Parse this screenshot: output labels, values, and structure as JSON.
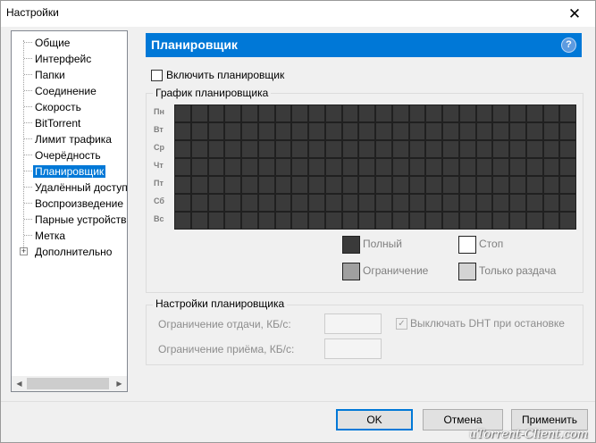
{
  "window": {
    "title": "Настройки",
    "close_glyph": "✕"
  },
  "sidebar": {
    "items": [
      {
        "label": "Общие",
        "selected": false
      },
      {
        "label": "Интерфейс",
        "selected": false
      },
      {
        "label": "Папки",
        "selected": false
      },
      {
        "label": "Соединение",
        "selected": false
      },
      {
        "label": "Скорость",
        "selected": false
      },
      {
        "label": "BitTorrent",
        "selected": false
      },
      {
        "label": "Лимит трафика",
        "selected": false
      },
      {
        "label": "Очерёдность",
        "selected": false
      },
      {
        "label": "Планировщик",
        "selected": true
      },
      {
        "label": "Удалённый доступ",
        "selected": false
      },
      {
        "label": "Воспроизведение",
        "selected": false
      },
      {
        "label": "Парные устройства",
        "selected": false
      },
      {
        "label": "Метка",
        "selected": false
      },
      {
        "label": "Дополнительно",
        "selected": false,
        "expandable": true
      }
    ],
    "expand_glyph": "+",
    "scroll_left_glyph": "◀",
    "scroll_right_glyph": "▶"
  },
  "panel": {
    "title": "Планировщик",
    "help_glyph": "?",
    "enable_label": "Включить планировщик",
    "enable_checked": false
  },
  "schedule": {
    "group_title": "График планировщика",
    "days": [
      "Пн",
      "Вт",
      "Ср",
      "Чт",
      "Пт",
      "Сб",
      "Вс"
    ],
    "hours": 24,
    "cell_state": "full",
    "legend": {
      "full": "Полный",
      "stop": "Стоп",
      "limit": "Ограничение",
      "seed_only": "Только раздача"
    }
  },
  "settings": {
    "group_title": "Настройки планировщика",
    "upload_limit_label": "Ограничение отдачи, КБ/с:",
    "upload_limit_value": "",
    "download_limit_label": "Ограничение приёма, КБ/с:",
    "download_limit_value": "",
    "dht_label": "Выключать DHT при остановке",
    "dht_checked": true,
    "dht_check_glyph": "✓"
  },
  "buttons": {
    "ok": "OK",
    "cancel": "Отмена",
    "apply": "Применить"
  },
  "watermark": "uTorrent-Client.com",
  "colors": {
    "accent": "#0078d7",
    "cell_full": "#3a3a3a",
    "legend_full": "#3a3a3a",
    "legend_stop": "#ffffff",
    "legend_limit": "#a0a0a0",
    "legend_seed_only": "#d4d4d4"
  }
}
